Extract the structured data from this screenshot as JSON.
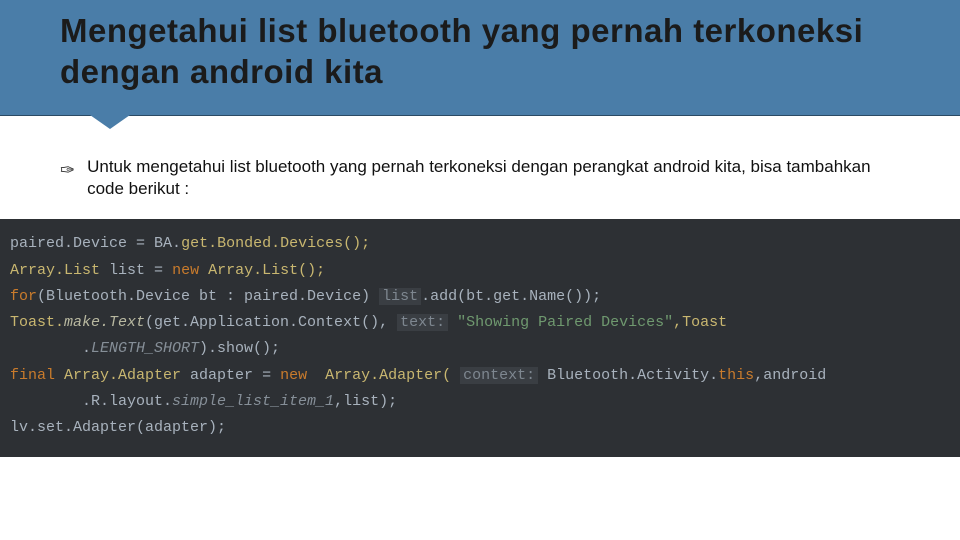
{
  "header": {
    "title": "Mengetahui list bluetooth yang pernah terkoneksi dengan android kita"
  },
  "bullet": {
    "symbol": "✑",
    "text": "Untuk mengetahui list bluetooth yang pernah terkoneksi dengan perangkat android kita, bisa tambahkan code berikut :"
  },
  "code": {
    "l1a": "paired.Device ",
    "l1b": "=",
    "l1c": " BA.",
    "l1d": "get.Bonded.Devices();",
    "l2a": "Array.List ",
    "l2b": "list ",
    "l2c": "=",
    "l2d": " new ",
    "l2e": "Array.List();",
    "l3a": "for",
    "l3b": "(Bluetooth.Device bt : paired.Device) ",
    "l3c": "list",
    "l3d": ".add(bt.get.Name());",
    "l4a": "Toast.",
    "l4b": "make.Text",
    "l4c": "(get.Application.Context(), ",
    "l4d": "text:",
    "l4e": " \"Showing Paired Devices\"",
    "l4f": ",Toast",
    "l5a": "        .",
    "l5b": "LENGTH_SHORT",
    "l5c": ").show();",
    "l6a": "final ",
    "l6b": "Array.Adapter ",
    "l6c": "adapter ",
    "l6d": "=",
    "l6e": " new  ",
    "l6f": "Array.Adapter( ",
    "l6g": "context:",
    "l6h": " Bluetooth.Activity.",
    "l6i": "this",
    "l6j": ",android",
    "l7a": "        .R.layout.",
    "l7b": "simple_list_item_1",
    "l7c": ",list);",
    "l8a": "lv",
    "l8b": ".set.Adapter(adapter);"
  }
}
